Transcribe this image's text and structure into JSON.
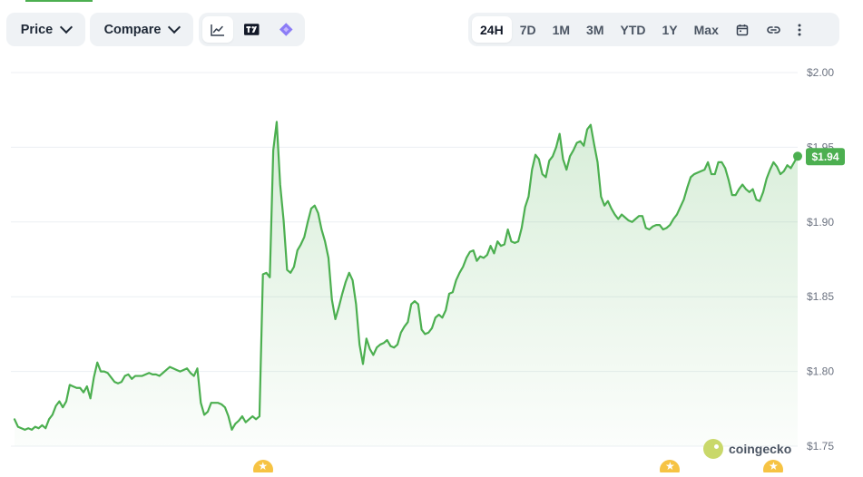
{
  "toolbar": {
    "price_label": "Price",
    "compare_label": "Compare",
    "chart_types": [
      {
        "icon": "line-chart-icon",
        "active": true
      },
      {
        "icon": "tradingview-icon",
        "active": false
      },
      {
        "icon": "diamond-logo-icon",
        "active": false
      }
    ],
    "ranges": [
      "24H",
      "7D",
      "1M",
      "3M",
      "YTD",
      "1Y",
      "Max"
    ],
    "active_range": "24H",
    "extra_icons": [
      "calendar-icon",
      "link-icon",
      "more-vertical-icon"
    ]
  },
  "brand": "coingecko",
  "colors": {
    "line": "#4caf50",
    "badge": "#4caf50",
    "grid": "#eceff3",
    "axis_text": "#6b7280"
  },
  "chart_data": {
    "type": "area",
    "title": "",
    "xlabel": "",
    "ylabel": "",
    "ylim": [
      1.75,
      2.0
    ],
    "yticks": [
      1.75,
      1.8,
      1.85,
      1.9,
      1.95,
      2.0
    ],
    "ytick_labels": [
      "$1.75",
      "$1.80",
      "$1.85",
      "$1.90",
      "$1.95",
      "$2.00"
    ],
    "grid": true,
    "current_price_label": "$1.94",
    "series": [
      {
        "values": [
          1.768,
          1.763,
          1.762,
          1.761,
          1.762,
          1.761,
          1.763,
          1.762,
          1.764,
          1.762,
          1.768,
          1.771,
          1.777,
          1.78,
          1.776,
          1.78,
          1.791,
          1.79,
          1.789,
          1.789,
          1.786,
          1.79,
          1.782,
          1.796,
          1.806,
          1.8,
          1.8,
          1.799,
          1.796,
          1.793,
          1.792,
          1.793,
          1.797,
          1.798,
          1.795,
          1.797,
          1.797,
          1.797,
          1.798,
          1.799,
          1.798,
          1.798,
          1.797,
          1.799,
          1.801,
          1.803,
          1.802,
          1.801,
          1.8,
          1.801,
          1.802,
          1.799,
          1.797,
          1.802,
          1.779,
          1.771,
          1.773,
          1.779,
          1.779,
          1.779,
          1.778,
          1.776,
          1.77,
          1.761,
          1.765,
          1.767,
          1.77,
          1.766,
          1.768,
          1.77,
          1.768,
          1.77,
          1.865,
          1.866,
          1.863,
          1.948,
          1.967,
          1.925,
          1.901,
          1.868,
          1.866,
          1.87,
          1.881,
          1.885,
          1.89,
          1.9,
          1.909,
          1.911,
          1.906,
          1.895,
          1.887,
          1.876,
          1.848,
          1.835,
          1.843,
          1.852,
          1.86,
          1.866,
          1.861,
          1.845,
          1.818,
          1.805,
          1.822,
          1.815,
          1.811,
          1.816,
          1.818,
          1.819,
          1.821,
          1.817,
          1.816,
          1.818,
          1.826,
          1.83,
          1.833,
          1.845,
          1.847,
          1.845,
          1.828,
          1.825,
          1.826,
          1.829,
          1.836,
          1.838,
          1.836,
          1.841,
          1.852,
          1.853,
          1.861,
          1.866,
          1.87,
          1.876,
          1.88,
          1.881,
          1.874,
          1.877,
          1.876,
          1.878,
          1.884,
          1.879,
          1.887,
          1.884,
          1.885,
          1.895,
          1.887,
          1.886,
          1.887,
          1.896,
          1.91,
          1.917,
          1.935,
          1.945,
          1.942,
          1.932,
          1.93,
          1.941,
          1.944,
          1.95,
          1.959,
          1.942,
          1.935,
          1.944,
          1.948,
          1.953,
          1.954,
          1.951,
          1.962,
          1.965,
          1.952,
          1.94,
          1.917,
          1.911,
          1.914,
          1.909,
          1.905,
          1.902,
          1.905,
          1.903,
          1.901,
          1.9,
          1.902,
          1.904,
          1.904,
          1.896,
          1.895,
          1.897,
          1.898,
          1.898,
          1.895,
          1.896,
          1.898,
          1.902,
          1.905,
          1.91,
          1.915,
          1.923,
          1.93,
          1.932,
          1.933,
          1.934,
          1.935,
          1.94,
          1.932,
          1.932,
          1.94,
          1.94,
          1.936,
          1.928,
          1.918,
          1.918,
          1.922,
          1.925,
          1.922,
          1.92,
          1.922,
          1.915,
          1.914,
          1.92,
          1.929,
          1.935,
          1.94,
          1.937,
          1.932,
          1.934,
          1.938,
          1.936,
          1.94,
          1.944
        ]
      }
    ],
    "markers": [
      {
        "index": 72,
        "type": "star"
      },
      {
        "index": 190,
        "type": "star"
      },
      {
        "index": 220,
        "type": "star"
      }
    ]
  }
}
